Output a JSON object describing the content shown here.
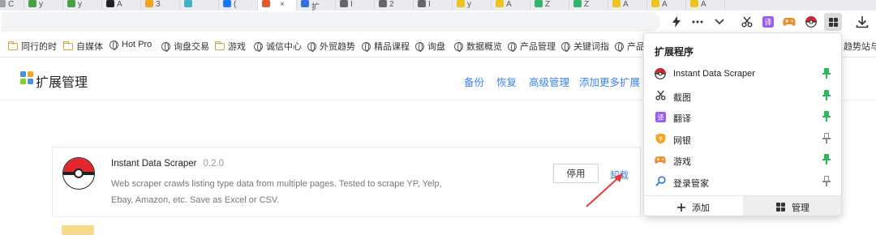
{
  "browser": {
    "tabs": [
      {
        "label": "C",
        "color": "#9aa0a6"
      },
      {
        "label": "y",
        "color": "#43a047"
      },
      {
        "label": "y",
        "color": "#43a047"
      },
      {
        "label": "A",
        "color": "#222222"
      },
      {
        "label": "3",
        "color": "#f4a51c"
      },
      {
        "label": "",
        "color": "#3fb0c5"
      },
      {
        "label": "(",
        "color": "#1677ff"
      },
      {
        "label": "",
        "color": "#e4572e",
        "active": true
      },
      {
        "label": "扩",
        "color": "#2f6fe0"
      },
      {
        "label": "I",
        "color": "#666666"
      },
      {
        "label": "2",
        "color": "#666666"
      },
      {
        "label": "I",
        "color": "#666666"
      },
      {
        "label": "y",
        "color": "#f0c419"
      },
      {
        "label": "A",
        "color": "#f0c419"
      },
      {
        "label": "Z",
        "color": "#35b36b"
      },
      {
        "label": "Z",
        "color": "#35b36b"
      },
      {
        "label": "A",
        "color": "#f0c419"
      },
      {
        "label": "A",
        "color": "#f0c419"
      },
      {
        "label": "A",
        "color": "#f0c419"
      }
    ],
    "toolbar_icons": [
      "lightning-icon",
      "more-icon",
      "chevron-down-icon",
      "scissors-icon",
      "translate-icon",
      "game-icon",
      "pokeball-icon",
      "extensions-icon",
      "download-icon"
    ],
    "bookmarks": [
      {
        "label": "同行的时",
        "icon": "folder"
      },
      {
        "label": "自媒体",
        "icon": "folder"
      },
      {
        "label": "Hot Pro",
        "icon": "globe"
      },
      {
        "label": "询盘交易",
        "icon": "globe"
      },
      {
        "label": "游戏",
        "icon": "folder"
      },
      {
        "label": "诚信中心",
        "icon": "globe"
      },
      {
        "label": "外贸趋势",
        "icon": "globe"
      },
      {
        "label": "精品课程",
        "icon": "globe"
      },
      {
        "label": "询盘",
        "icon": "globe"
      },
      {
        "label": "数据概览",
        "icon": "globe"
      },
      {
        "label": "产品管理",
        "icon": "globe"
      },
      {
        "label": "关键词指",
        "icon": "globe"
      },
      {
        "label": "产品",
        "icon": "globe"
      },
      {
        "label": "趋势站与与",
        "icon": "none"
      }
    ]
  },
  "page": {
    "title": "扩展管理",
    "links": {
      "backup": "备份",
      "restore": "恢复",
      "advanced": "高级管理",
      "add_more": "添加更多扩展"
    },
    "extension": {
      "name": "Instant Data Scraper",
      "version": "0.2.0",
      "description": "Web scraper crawls listing type data from multiple pages. Tested to scrape YP, Yelp, Ebay, Amazon, etc. Save as Excel or CSV.",
      "disable_label": "停用",
      "uninstall_label": "卸载"
    }
  },
  "popup": {
    "title": "扩展程序",
    "items": [
      {
        "label": "Instant Data Scraper",
        "icon": "pokeball-icon",
        "pinned": true
      },
      {
        "label": "截图",
        "icon": "scissors-icon",
        "pinned": true
      },
      {
        "label": "翻译",
        "icon": "translate-icon",
        "pinned": true
      },
      {
        "label": "网银",
        "icon": "shield-icon",
        "pinned": false
      },
      {
        "label": "游戏",
        "icon": "game-icon",
        "pinned": true
      },
      {
        "label": "登录管家",
        "icon": "search-key-icon",
        "pinned": false
      }
    ],
    "add_label": "添加",
    "manage_label": "管理"
  },
  "colors": {
    "accent_blue": "#3a83f0",
    "pin_green": "#2eb85c",
    "pin_gray": "#8a8a8a",
    "arrow_red": "#e53935"
  }
}
